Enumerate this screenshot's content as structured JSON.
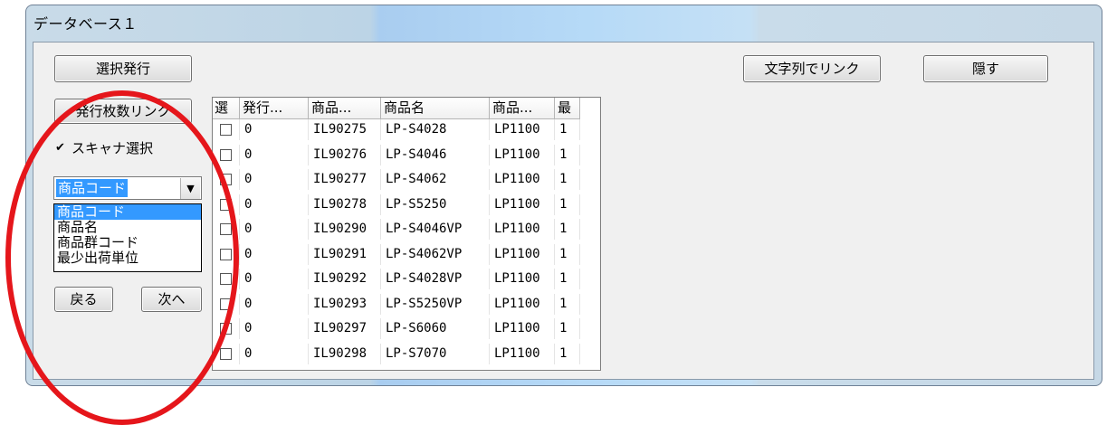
{
  "window": {
    "title": "データベース１"
  },
  "toolbar": {
    "select_issue_label": "選択発行",
    "link_by_string_label": "文字列でリンク",
    "hide_label": "隠す"
  },
  "left_panel": {
    "issue_count_link_label": "発行枚数リンク",
    "scanner_select": {
      "checked": true,
      "check_glyph": "✔",
      "label": "スキャナ選択"
    },
    "field_combo": {
      "value": "商品コード",
      "arrow_icon": "▼"
    },
    "field_options": [
      "商品コード",
      "商品名",
      "商品群コード",
      "最少出荷単位"
    ],
    "back_label": "戻る",
    "next_label": "次へ"
  },
  "grid": {
    "columns": [
      "選",
      "発行...",
      "商品...",
      "商品名",
      "商品...",
      "最"
    ],
    "rows": [
      {
        "issued": "0",
        "code": "IL90275",
        "name": "LP-S4028",
        "group": "LP1100",
        "min": "1"
      },
      {
        "issued": "0",
        "code": "IL90276",
        "name": "LP-S4046",
        "group": "LP1100",
        "min": "1"
      },
      {
        "issued": "0",
        "code": "IL90277",
        "name": "LP-S4062",
        "group": "LP1100",
        "min": "1"
      },
      {
        "issued": "0",
        "code": "IL90278",
        "name": "LP-S5250",
        "group": "LP1100",
        "min": "1"
      },
      {
        "issued": "0",
        "code": "IL90290",
        "name": "LP-S4046VP",
        "group": "LP1100",
        "min": "1"
      },
      {
        "issued": "0",
        "code": "IL90291",
        "name": "LP-S4062VP",
        "group": "LP1100",
        "min": "1"
      },
      {
        "issued": "0",
        "code": "IL90292",
        "name": "LP-S4028VP",
        "group": "LP1100",
        "min": "1"
      },
      {
        "issued": "0",
        "code": "IL90293",
        "name": "LP-S5250VP",
        "group": "LP1100",
        "min": "1"
      },
      {
        "issued": "0",
        "code": "IL90297",
        "name": "LP-S6060",
        "group": "LP1100",
        "min": "1"
      },
      {
        "issued": "0",
        "code": "IL90298",
        "name": "LP-S7070",
        "group": "LP1100",
        "min": "1"
      }
    ]
  },
  "colors": {
    "annotation": "#e5161b",
    "selection": "#3399ff"
  }
}
